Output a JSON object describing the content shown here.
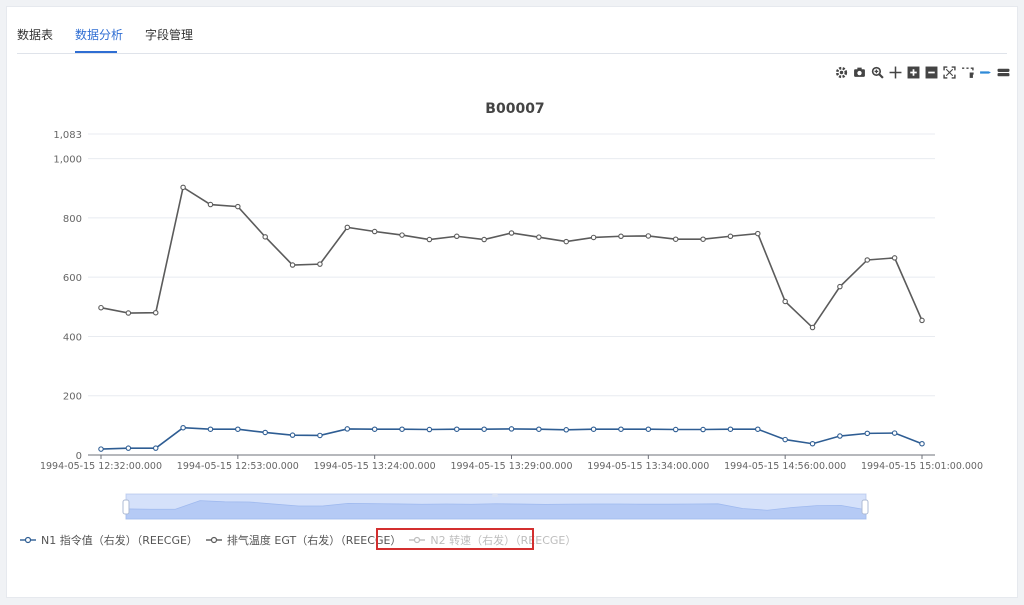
{
  "tabs": [
    {
      "label": "数据表",
      "active": false
    },
    {
      "label": "数据分析",
      "active": true
    },
    {
      "label": "字段管理",
      "active": false
    }
  ],
  "toolbar": [
    {
      "icon": "gear-icon"
    },
    {
      "icon": "camera-icon"
    },
    {
      "icon": "zoom-in-icon"
    },
    {
      "icon": "move-icon"
    },
    {
      "icon": "plus-square-icon"
    },
    {
      "icon": "minus-square-icon"
    },
    {
      "icon": "fit-screen-icon"
    },
    {
      "icon": "select-region-icon"
    },
    {
      "icon": "line-toggle-icon",
      "active": true
    },
    {
      "icon": "stack-icon"
    }
  ],
  "colors": {
    "accent": "#2f6ed3",
    "series1": "#2e5d93",
    "series2": "#5b5b5b",
    "inactive": "#bdbdbd",
    "highlight": "#d32f2f"
  },
  "chart_data": {
    "type": "line",
    "title": "B00007",
    "ylim": [
      0,
      1083
    ],
    "yticks": [
      0,
      200,
      400,
      600,
      800,
      1000,
      1083
    ],
    "ytick_labels": [
      "0",
      "200",
      "400",
      "600",
      "800",
      "1,000",
      "1,083"
    ],
    "x_tick_labels": [
      "1994-05-15 12:32:00.000",
      "1994-05-15 12:53:00.000",
      "1994-05-15 13:24:00.000",
      "1994-05-15 13:29:00.000",
      "1994-05-15 13:34:00.000",
      "1994-05-15 14:56:00.000",
      "1994-05-15 15:01:00.000"
    ],
    "grid": true,
    "series": [
      {
        "name": "N1 指令值（右发）（REECGE）",
        "color": "#2e5d93",
        "visible": true,
        "values": [
          20,
          23,
          23,
          92,
          87,
          87,
          76,
          67,
          66,
          88,
          87,
          87,
          86,
          87,
          87,
          88,
          87,
          85,
          87,
          87,
          87,
          86,
          86,
          87,
          87,
          52,
          38,
          64,
          73,
          74,
          38
        ]
      },
      {
        "name": "排气温度 EGT（右发）（REECGE）",
        "color": "#5b5b5b",
        "visible": true,
        "values": [
          497,
          479,
          480,
          903,
          845,
          838,
          736,
          641,
          644,
          768,
          754,
          742,
          727,
          738,
          727,
          749,
          735,
          720,
          734,
          738,
          739,
          728,
          728,
          738,
          747,
          518,
          430,
          568,
          658,
          665,
          454
        ]
      },
      {
        "name": "N2 转速（右发）（REECGE）",
        "color": "#bdbdbd",
        "visible": false,
        "values": []
      }
    ]
  }
}
